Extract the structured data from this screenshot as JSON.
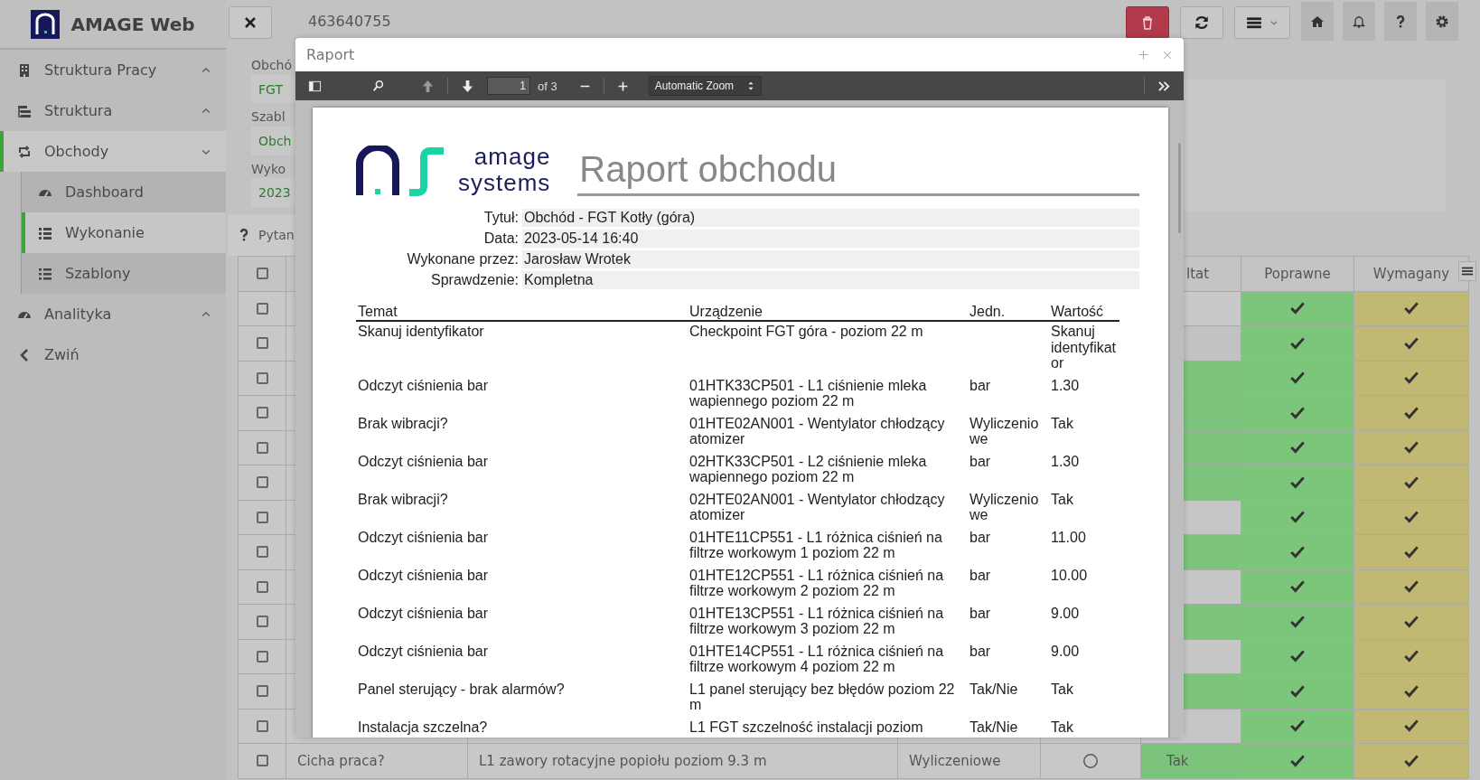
{
  "sidebar": {
    "brand": "AMAGE Web",
    "items": [
      {
        "label": "Struktura Pracy",
        "kind": "building",
        "expanded": false,
        "selected": false
      },
      {
        "label": "Struktura",
        "kind": "tree",
        "expanded": false,
        "selected": false
      },
      {
        "label": "Obchody",
        "kind": "loop",
        "expanded": true,
        "selected": true,
        "children": [
          {
            "label": "Dashboard",
            "kind": "gauge",
            "selected": false
          },
          {
            "label": "Wykonanie",
            "kind": "checklist",
            "selected": true
          },
          {
            "label": "Szablony",
            "kind": "list",
            "selected": false
          }
        ]
      },
      {
        "label": "Analityka",
        "kind": "gauge",
        "expanded": false,
        "selected": false
      },
      {
        "label": "Zwiń",
        "kind": "collapse"
      }
    ]
  },
  "topbar": {
    "record_id": "463640755"
  },
  "details": {
    "fields": [
      {
        "label": "Obchó",
        "value": "FGT"
      },
      {
        "label": "Szabl",
        "value": "Obch"
      },
      {
        "label": "Wyko",
        "value": "2023"
      }
    ]
  },
  "questions": {
    "tab": "Pytan",
    "all_checked": false,
    "result_header": "ltat",
    "correct_header": "Poprawne",
    "required_header": "Wymagany",
    "rows": [
      {
        "checked": false,
        "color": "#c9c9c9",
        "correct": true,
        "required": true
      },
      {
        "checked": false,
        "color": "#c2c2c2",
        "correct": true,
        "required": true
      },
      {
        "checked": false,
        "color": "#7cc47b",
        "correct": true,
        "required": true
      },
      {
        "checked": false,
        "color": "#7cc47b",
        "correct": true,
        "required": true
      },
      {
        "checked": false,
        "color": "#7cc47b",
        "correct": true,
        "required": true
      },
      {
        "checked": false,
        "color": "#7cc47b",
        "correct": true,
        "required": true
      },
      {
        "checked": false,
        "color": "#c6c6c6",
        "correct": true,
        "required": true
      },
      {
        "checked": false,
        "color": "#7cc47b",
        "correct": true,
        "required": true
      },
      {
        "checked": false,
        "color": "#c6c6c6",
        "correct": true,
        "required": true
      },
      {
        "checked": false,
        "color": "#7cc47b",
        "correct": true,
        "required": true
      },
      {
        "checked": false,
        "color": "#c6c6c6",
        "correct": true,
        "required": true
      },
      {
        "checked": false,
        "color": "#7cc47b",
        "correct": true,
        "required": true
      },
      {
        "checked": false,
        "color": "#c6c6c6",
        "correct": true,
        "required": true
      },
      {
        "checked": false,
        "color": "#7cc47b",
        "correct": true,
        "required": true,
        "question": "Cicha praca?",
        "device": "L1 zawory rotacyjne popiołu poziom 9.3 m",
        "type": "Wyliczeniowe",
        "result": "Tak"
      }
    ]
  },
  "modal": {
    "title": "Raport",
    "viewer": {
      "page": "1",
      "page_count": "of 3",
      "zoom": "Automatic Zoom"
    },
    "report": {
      "logo_line_1": "amage",
      "logo_line_2": "systems",
      "title": "Raport obchodu",
      "info": [
        {
          "label": "Tytuł:",
          "value": "Obchód - FGT Kotły (góra)"
        },
        {
          "label": "Data:",
          "value": "2023-05-14 16:40"
        },
        {
          "label": "Wykonane przez:",
          "value": "Jarosław Wrotek"
        },
        {
          "label": "Sprawdzenie:",
          "value": "Kompletna"
        }
      ],
      "columns": [
        "Temat",
        "Urządzenie",
        "Jedn.",
        "Wartość"
      ],
      "rows": [
        {
          "topic": "Skanuj identyfikator",
          "device": "Checkpoint FGT góra - poziom 22 m",
          "value": "Skanuj identyfikator"
        },
        {
          "topic": "Odczyt ciśnienia bar",
          "device": "01HTK33CP501 - L1 ciśnienie mleka wapiennego poziom 22 m",
          "unit": "bar",
          "value": "1.30"
        },
        {
          "topic": "Brak wibracji?",
          "device": "01HTE02AN001 - Wentylator chłodzący atomizer",
          "unit": "Wyliczeniowe",
          "value": "Tak"
        },
        {
          "topic": "Odczyt ciśnienia bar",
          "device": "02HTK33CP501 - L2 ciśnienie mleka wapiennego poziom 22 m",
          "unit": "bar",
          "value": "1.30"
        },
        {
          "topic": "Brak wibracji?",
          "device": "02HTE02AN001 - Wentylator chłodzący atomizer",
          "unit": "Wyliczeniowe",
          "value": "Tak"
        },
        {
          "topic": "Odczyt ciśnienia bar",
          "device": "01HTE11CP551 - L1 różnica ciśnień na filtrze workowym 1 poziom 22 m",
          "unit": "bar",
          "value": "11.00"
        },
        {
          "topic": "Odczyt ciśnienia bar",
          "device": "01HTE12CP551 - L1 różnica ciśnień na filtrze workowym 2 poziom 22 m",
          "unit": "bar",
          "value": "10.00"
        },
        {
          "topic": "Odczyt ciśnienia bar",
          "device": "01HTE13CP551 - L1 różnica ciśnień na filtrze workowym 3 poziom 22 m",
          "unit": "bar",
          "value": "9.00"
        },
        {
          "topic": "Odczyt ciśnienia bar",
          "device": "01HTE14CP551 - L1 różnica ciśnień na filtrze workowym 4 poziom 22 m",
          "unit": "bar",
          "value": "9.00"
        },
        {
          "topic": "Panel sterujący - brak alarmów?",
          "device": "L1 panel sterujący bez błędów poziom 22 m",
          "unit": "Tak/Nie",
          "value": "Tak"
        },
        {
          "topic": "Instalacja szczelna?",
          "device": "L1 FGT szczelność instalacji poziom",
          "unit": "Tak/Nie",
          "value": "Tak"
        }
      ]
    }
  }
}
